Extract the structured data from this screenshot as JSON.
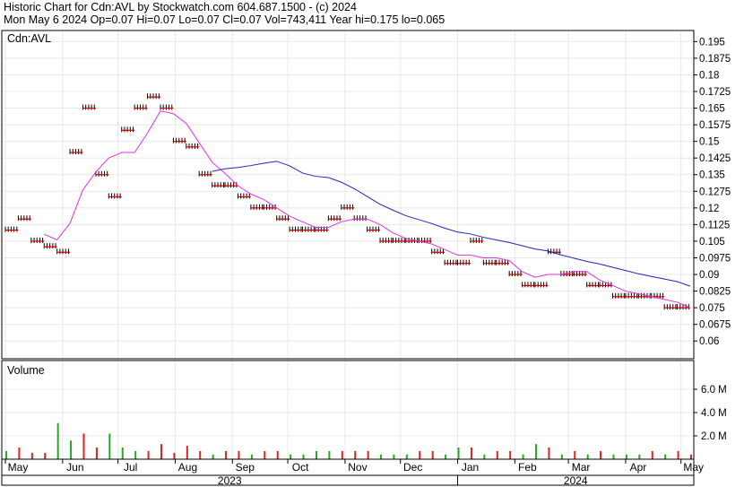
{
  "header": {
    "line1": "Historic Chart for Cdn:AVL by Stockwatch.com 604.687.1500 - (c) 2024",
    "line2": "Mon May  6 2024  Op=0.07  Hi=0.07  Lo=0.07  Cl=0.07  Vol=743,411  Year hi=0.175  lo=0.065"
  },
  "colors": {
    "bar": "#000000",
    "close_tick": "#cc0000",
    "ma_short": "#dd33dd",
    "ma_long": "#2222bb",
    "volume_up": "#22aa22",
    "volume_down": "#dd2222",
    "grid": "#e8e8e8",
    "frame": "#000000"
  },
  "chart_data": {
    "type": "ohlc",
    "price_panel": {
      "label": "Cdn:AVL",
      "ylim": [
        0.052,
        0.2
      ],
      "yticks": [
        "0.195",
        "0.1875",
        "0.18",
        "0.1725",
        "0.165",
        "0.1575",
        "0.15",
        "0.1425",
        "0.135",
        "0.1275",
        "0.12",
        "0.1125",
        "0.105",
        "0.0975",
        "0.09",
        "0.0825",
        "0.075",
        "0.0675",
        "0.06"
      ]
    },
    "volume_panel": {
      "label": "Volume",
      "ylim": [
        0,
        8
      ],
      "unit": "M",
      "yticks": [
        "6.0 M",
        "4.0 M",
        "2.0 M"
      ]
    },
    "x_axis": {
      "months": [
        "May",
        "Jun",
        "Jul",
        "Aug",
        "Sep",
        "Oct",
        "Nov",
        "Dec",
        "Jan",
        "Feb",
        "Mar",
        "Apr",
        "May"
      ],
      "years": [
        "2023",
        "2024"
      ],
      "range": [
        "2023-05-01",
        "2024-05-06"
      ]
    },
    "price_series": [
      {
        "date": "2023-05-01",
        "close": 0.11
      },
      {
        "date": "2023-05-08",
        "close": 0.115
      },
      {
        "date": "2023-05-15",
        "close": 0.105
      },
      {
        "date": "2023-05-22",
        "close": 0.1025
      },
      {
        "date": "2023-05-29",
        "close": 0.1
      },
      {
        "date": "2023-06-05",
        "close": 0.145
      },
      {
        "date": "2023-06-12",
        "close": 0.165
      },
      {
        "date": "2023-06-19",
        "close": 0.135
      },
      {
        "date": "2023-06-26",
        "close": 0.125
      },
      {
        "date": "2023-07-03",
        "close": 0.155
      },
      {
        "date": "2023-07-10",
        "close": 0.165
      },
      {
        "date": "2023-07-17",
        "close": 0.17
      },
      {
        "date": "2023-07-24",
        "close": 0.165
      },
      {
        "date": "2023-07-31",
        "close": 0.15
      },
      {
        "date": "2023-08-07",
        "close": 0.1475
      },
      {
        "date": "2023-08-14",
        "close": 0.135
      },
      {
        "date": "2023-08-21",
        "close": 0.13
      },
      {
        "date": "2023-08-28",
        "close": 0.13
      },
      {
        "date": "2023-09-04",
        "close": 0.125
      },
      {
        "date": "2023-09-11",
        "close": 0.12
      },
      {
        "date": "2023-09-18",
        "close": 0.12
      },
      {
        "date": "2023-09-25",
        "close": 0.115
      },
      {
        "date": "2023-10-02",
        "close": 0.11
      },
      {
        "date": "2023-10-09",
        "close": 0.11
      },
      {
        "date": "2023-10-16",
        "close": 0.11
      },
      {
        "date": "2023-10-23",
        "close": 0.115
      },
      {
        "date": "2023-10-30",
        "close": 0.12
      },
      {
        "date": "2023-11-06",
        "close": 0.115
      },
      {
        "date": "2023-11-13",
        "close": 0.11
      },
      {
        "date": "2023-11-20",
        "close": 0.105
      },
      {
        "date": "2023-11-27",
        "close": 0.105
      },
      {
        "date": "2023-12-04",
        "close": 0.105
      },
      {
        "date": "2023-12-11",
        "close": 0.105
      },
      {
        "date": "2023-12-18",
        "close": 0.1
      },
      {
        "date": "2023-12-25",
        "close": 0.095
      },
      {
        "date": "2024-01-01",
        "close": 0.095
      },
      {
        "date": "2024-01-08",
        "close": 0.105
      },
      {
        "date": "2024-01-15",
        "close": 0.095
      },
      {
        "date": "2024-01-22",
        "close": 0.095
      },
      {
        "date": "2024-01-29",
        "close": 0.09
      },
      {
        "date": "2024-02-05",
        "close": 0.085
      },
      {
        "date": "2024-02-12",
        "close": 0.085
      },
      {
        "date": "2024-02-19",
        "close": 0.1
      },
      {
        "date": "2024-02-26",
        "close": 0.09
      },
      {
        "date": "2024-03-04",
        "close": 0.09
      },
      {
        "date": "2024-03-11",
        "close": 0.085
      },
      {
        "date": "2024-03-18",
        "close": 0.085
      },
      {
        "date": "2024-03-25",
        "close": 0.08
      },
      {
        "date": "2024-04-01",
        "close": 0.08
      },
      {
        "date": "2024-04-08",
        "close": 0.08
      },
      {
        "date": "2024-04-15",
        "close": 0.08
      },
      {
        "date": "2024-04-22",
        "close": 0.075
      },
      {
        "date": "2024-04-29",
        "close": 0.075
      },
      {
        "date": "2024-05-06",
        "close": 0.07
      }
    ]
  }
}
